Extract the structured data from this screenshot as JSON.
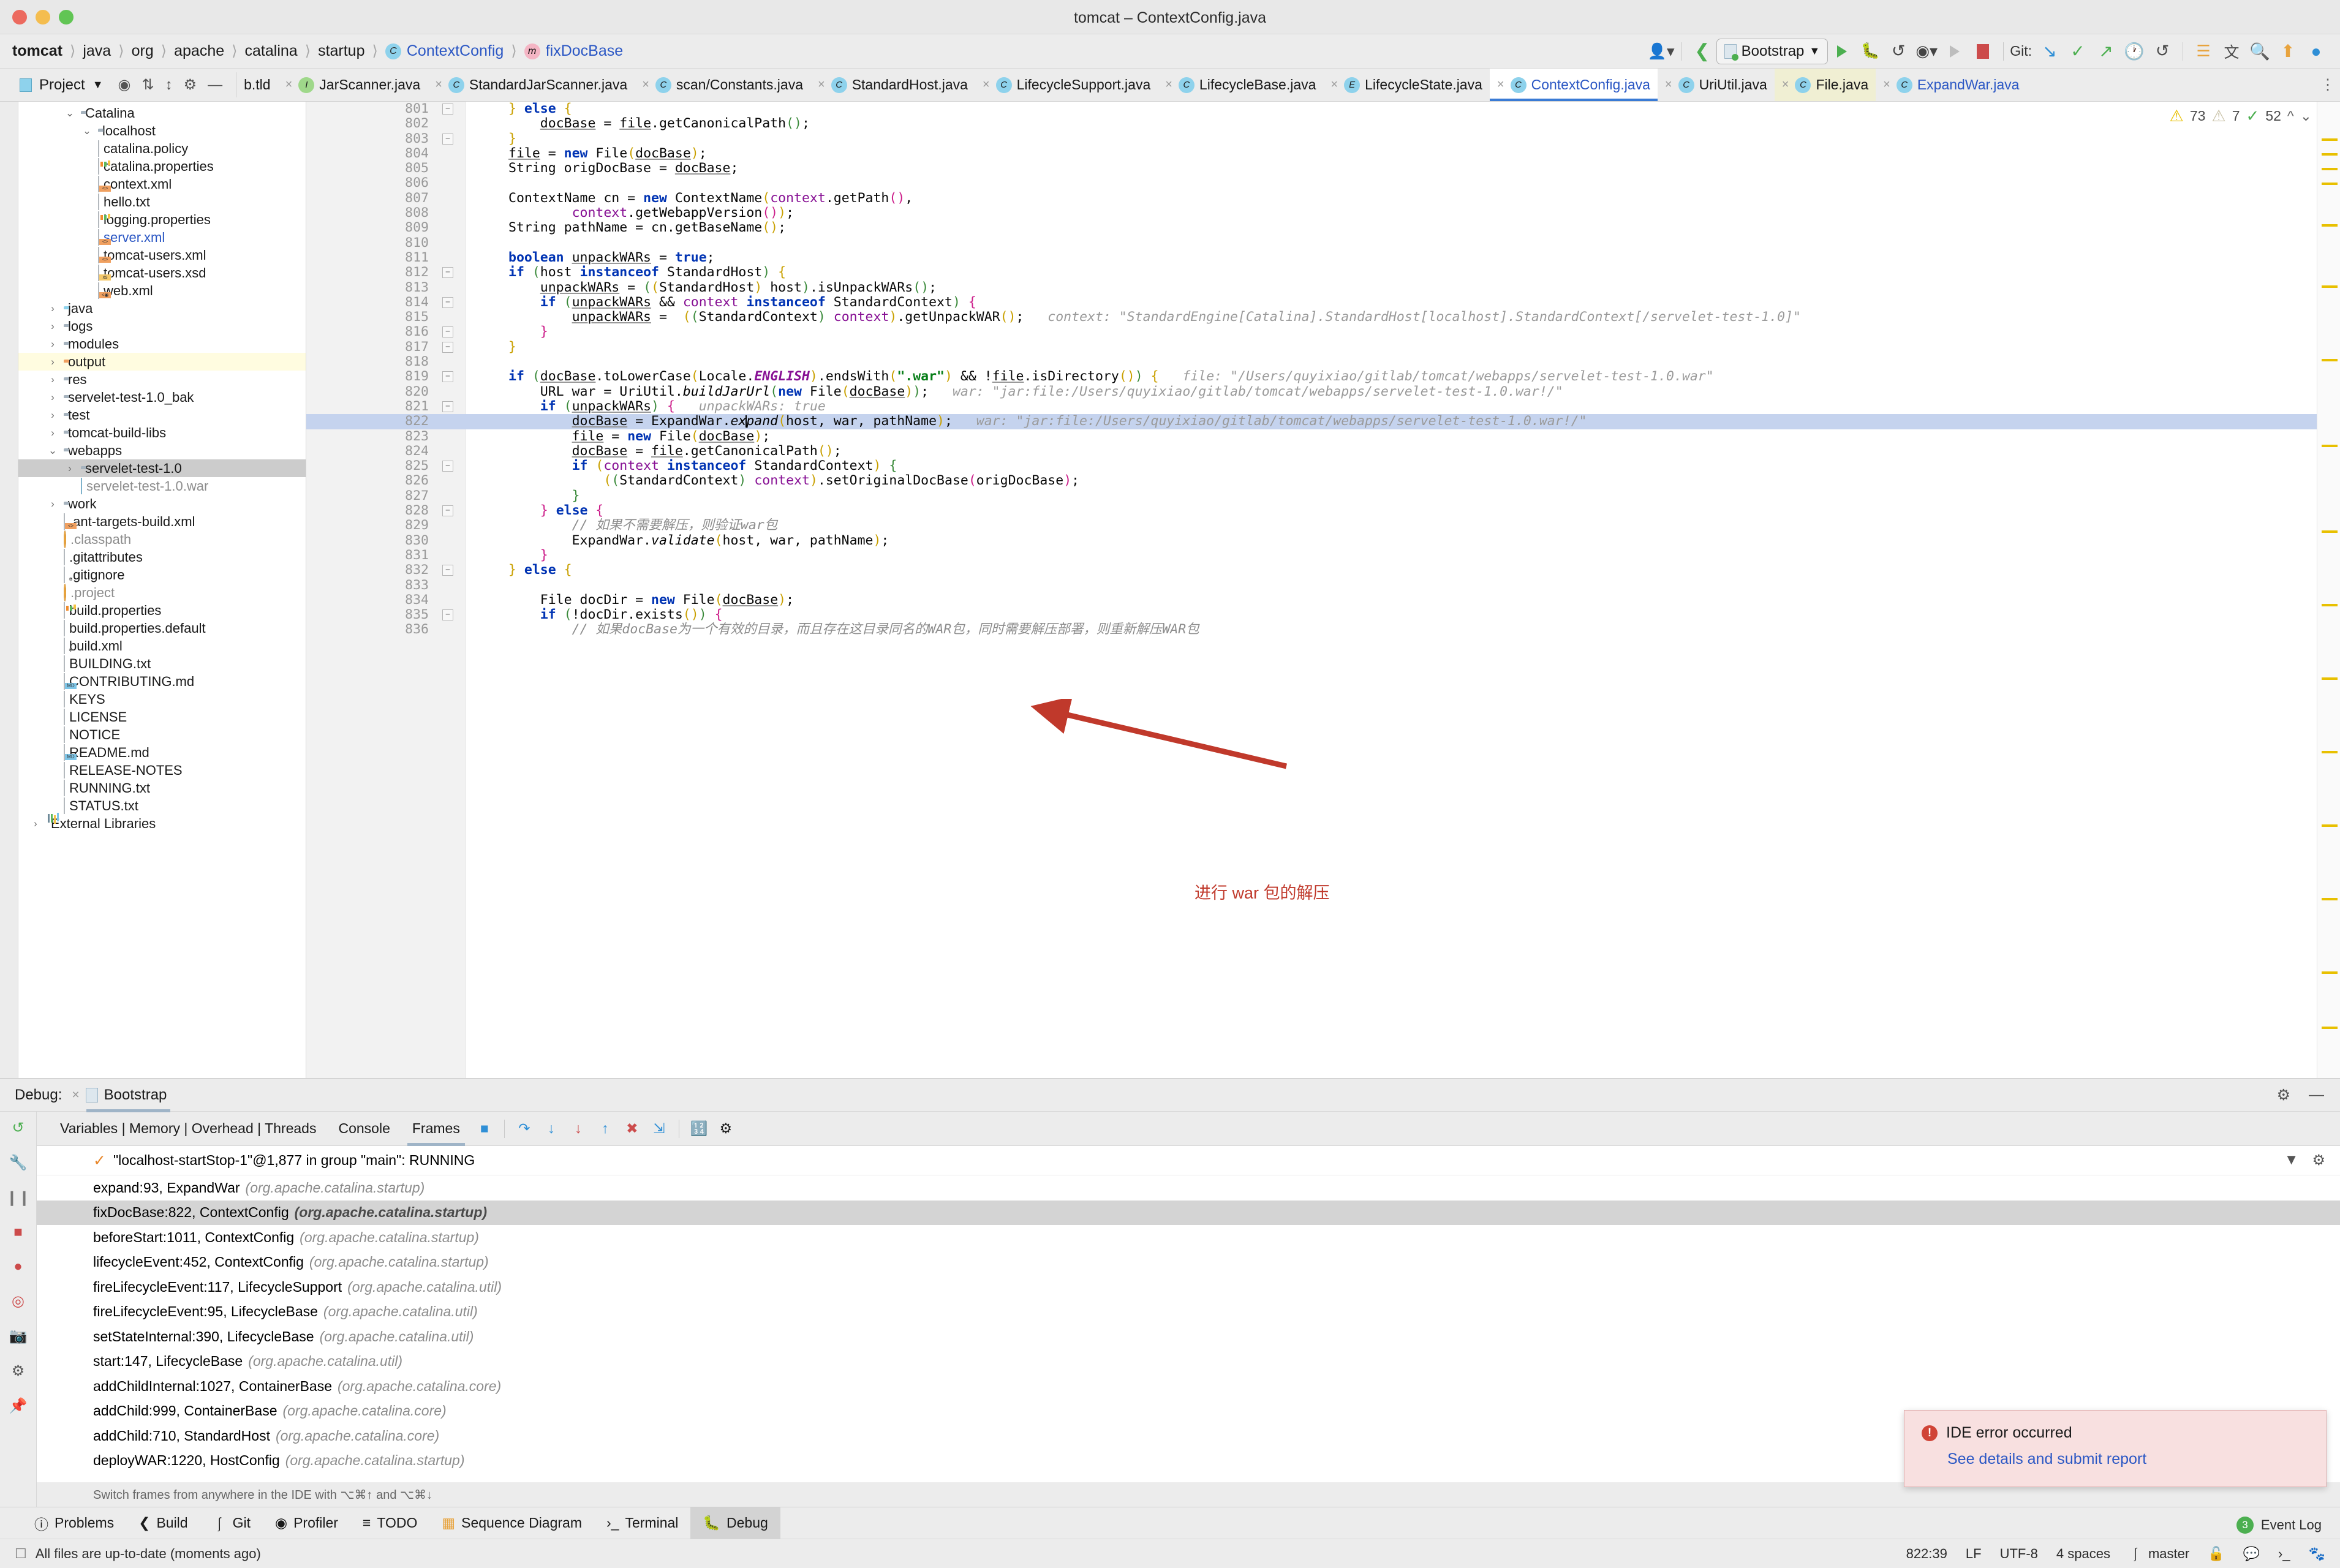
{
  "window": {
    "title": "tomcat – ContextConfig.java"
  },
  "breadcrumb": {
    "items": [
      {
        "label": "tomcat",
        "style": "bold"
      },
      {
        "label": "java",
        "style": "plain"
      },
      {
        "label": "org",
        "style": "plain"
      },
      {
        "label": "apache",
        "style": "plain"
      },
      {
        "label": "catalina",
        "style": "plain"
      },
      {
        "label": "startup",
        "style": "plain"
      },
      {
        "label": "ContextConfig",
        "style": "link",
        "badge": "C"
      },
      {
        "label": "fixDocBase",
        "style": "link",
        "badge": "m"
      }
    ]
  },
  "toolbar": {
    "run_config": "Bootstrap",
    "git_label": "Git:",
    "icons": [
      "user-avatar-icon",
      "back-arrow-icon",
      "run-icon",
      "debug-icon",
      "rerun-icon",
      "coverage-icon",
      "profile-icon",
      "stop-icon",
      "git-update-icon",
      "git-commit-icon",
      "git-push-icon",
      "git-history-icon",
      "git-rollback-icon",
      "diff-icon",
      "translate-icon",
      "search-icon",
      "update-icon",
      "colorpicker-icon"
    ]
  },
  "project_panel": {
    "title": "Project",
    "buttons": [
      "locate-icon",
      "collapse-icon",
      "expand-icon",
      "settings-icon",
      "hide-icon"
    ],
    "tree": [
      {
        "label": "Catalina",
        "indent": 2,
        "arrow": "down",
        "icon": "folder"
      },
      {
        "label": "localhost",
        "indent": 3,
        "arrow": "down",
        "icon": "folder"
      },
      {
        "label": "catalina.policy",
        "indent": 3,
        "arrow": "none",
        "icon": "text-file"
      },
      {
        "label": "catalina.properties",
        "indent": 3,
        "arrow": "none",
        "icon": "properties-file"
      },
      {
        "label": "context.xml",
        "indent": 3,
        "arrow": "none",
        "icon": "xml-file"
      },
      {
        "label": "hello.txt",
        "indent": 3,
        "arrow": "none",
        "icon": "text-file"
      },
      {
        "label": "logging.properties",
        "indent": 3,
        "arrow": "none",
        "icon": "properties-file"
      },
      {
        "label": "server.xml",
        "indent": 3,
        "arrow": "none",
        "icon": "xml-file",
        "color": "blue"
      },
      {
        "label": "tomcat-users.xml",
        "indent": 3,
        "arrow": "none",
        "icon": "xml-file"
      },
      {
        "label": "tomcat-users.xsd",
        "indent": 3,
        "arrow": "none",
        "icon": "xsd-file"
      },
      {
        "label": "web.xml",
        "indent": 3,
        "arrow": "none",
        "icon": "webxml-file"
      },
      {
        "label": "java",
        "indent": 1,
        "arrow": "right",
        "icon": "folder-blue"
      },
      {
        "label": "logs",
        "indent": 1,
        "arrow": "right",
        "icon": "folder"
      },
      {
        "label": "modules",
        "indent": 1,
        "arrow": "right",
        "icon": "folder"
      },
      {
        "label": "output",
        "indent": 1,
        "arrow": "right",
        "icon": "folder-orange",
        "row": "highlight"
      },
      {
        "label": "res",
        "indent": 1,
        "arrow": "right",
        "icon": "folder"
      },
      {
        "label": "servelet-test-1.0_bak",
        "indent": 1,
        "arrow": "right",
        "icon": "folder"
      },
      {
        "label": "test",
        "indent": 1,
        "arrow": "right",
        "icon": "folder"
      },
      {
        "label": "tomcat-build-libs",
        "indent": 1,
        "arrow": "right",
        "icon": "folder"
      },
      {
        "label": "webapps",
        "indent": 1,
        "arrow": "down",
        "icon": "folder"
      },
      {
        "label": "servelet-test-1.0",
        "indent": 2,
        "arrow": "right",
        "icon": "folder",
        "row": "selected"
      },
      {
        "label": "servelet-test-1.0.war",
        "indent": 2,
        "arrow": "none",
        "icon": "archive-file",
        "color": "grey"
      },
      {
        "label": "work",
        "indent": 1,
        "arrow": "right",
        "icon": "folder"
      },
      {
        "label": ".ant-targets-build.xml",
        "indent": 1,
        "arrow": "none",
        "icon": "xml-file"
      },
      {
        "label": ".classpath",
        "indent": 1,
        "arrow": "none",
        "icon": "eclipse-file",
        "color": "grey"
      },
      {
        "label": ".gitattributes",
        "indent": 1,
        "arrow": "none",
        "icon": "text-file"
      },
      {
        "label": ".gitignore",
        "indent": 1,
        "arrow": "none",
        "icon": "ignore-file"
      },
      {
        "label": ".project",
        "indent": 1,
        "arrow": "none",
        "icon": "eclipse-file",
        "color": "grey"
      },
      {
        "label": "build.properties",
        "indent": 1,
        "arrow": "none",
        "icon": "properties-file"
      },
      {
        "label": "build.properties.default",
        "indent": 1,
        "arrow": "none",
        "icon": "text-file"
      },
      {
        "label": "build.xml",
        "indent": 1,
        "arrow": "none",
        "icon": "ant-file"
      },
      {
        "label": "BUILDING.txt",
        "indent": 1,
        "arrow": "none",
        "icon": "text-file"
      },
      {
        "label": "CONTRIBUTING.md",
        "indent": 1,
        "arrow": "none",
        "icon": "markdown-file"
      },
      {
        "label": "KEYS",
        "indent": 1,
        "arrow": "none",
        "icon": "text-file"
      },
      {
        "label": "LICENSE",
        "indent": 1,
        "arrow": "none",
        "icon": "text-file"
      },
      {
        "label": "NOTICE",
        "indent": 1,
        "arrow": "none",
        "icon": "text-file"
      },
      {
        "label": "README.md",
        "indent": 1,
        "arrow": "none",
        "icon": "markdown-file"
      },
      {
        "label": "RELEASE-NOTES",
        "indent": 1,
        "arrow": "none",
        "icon": "text-file"
      },
      {
        "label": "RUNNING.txt",
        "indent": 1,
        "arrow": "none",
        "icon": "text-file"
      },
      {
        "label": "STATUS.txt",
        "indent": 1,
        "arrow": "none",
        "icon": "text-file"
      },
      {
        "label": "External Libraries",
        "indent": 0,
        "arrow": "right",
        "icon": "libraries"
      }
    ]
  },
  "editor_tabs": [
    {
      "label": "b.tld",
      "badge": "",
      "state": "clipped"
    },
    {
      "label": "JarScanner.java",
      "badge": "I",
      "state": "normal"
    },
    {
      "label": "StandardJarScanner.java",
      "badge": "C",
      "state": "normal"
    },
    {
      "label": "scan/Constants.java",
      "badge": "C",
      "state": "normal"
    },
    {
      "label": "StandardHost.java",
      "badge": "C",
      "state": "normal"
    },
    {
      "label": "LifecycleSupport.java",
      "badge": "C",
      "state": "normal"
    },
    {
      "label": "LifecycleBase.java",
      "badge": "C",
      "state": "normal"
    },
    {
      "label": "LifecycleState.java",
      "badge": "E",
      "state": "normal"
    },
    {
      "label": "ContextConfig.java",
      "badge": "C",
      "state": "active"
    },
    {
      "label": "UriUtil.java",
      "badge": "C",
      "state": "normal"
    },
    {
      "label": "File.java",
      "badge": "C",
      "state": "readonly"
    },
    {
      "label": "ExpandWar.java",
      "badge": "C",
      "state": "modified"
    }
  ],
  "inspector": {
    "warnings": "73",
    "weak_warnings": "7",
    "ok": "52"
  },
  "code": {
    "annotation": "进行 war 包的解压",
    "lines": [
      {
        "n": "801",
        "fold": "minus"
      },
      {
        "n": "802"
      },
      {
        "n": "803",
        "fold": "minus"
      },
      {
        "n": "804"
      },
      {
        "n": "805"
      },
      {
        "n": "806"
      },
      {
        "n": "807"
      },
      {
        "n": "808"
      },
      {
        "n": "809"
      },
      {
        "n": "810"
      },
      {
        "n": "811"
      },
      {
        "n": "812",
        "fold": "minus"
      },
      {
        "n": "813"
      },
      {
        "n": "814",
        "fold": "minus"
      },
      {
        "n": "815"
      },
      {
        "n": "816",
        "fold": "minus"
      },
      {
        "n": "817",
        "fold": "minus"
      },
      {
        "n": "818"
      },
      {
        "n": "819",
        "fold": "minus"
      },
      {
        "n": "820"
      },
      {
        "n": "821",
        "fold": "minus"
      },
      {
        "n": "822",
        "current": true
      },
      {
        "n": "823"
      },
      {
        "n": "824"
      },
      {
        "n": "825",
        "fold": "minus"
      },
      {
        "n": "826"
      },
      {
        "n": "827"
      },
      {
        "n": "828",
        "fold": "minus"
      },
      {
        "n": "829"
      },
      {
        "n": "830"
      },
      {
        "n": "831"
      },
      {
        "n": "832",
        "fold": "minus"
      },
      {
        "n": "833"
      },
      {
        "n": "834"
      },
      {
        "n": "835",
        "fold": "minus"
      },
      {
        "n": "836"
      }
    ],
    "inlay_hints": {
      "line_815": "context: \"StandardEngine[Catalina].StandardHost[localhost].StandardContext[/servelet-test-1.0]\"",
      "line_819": "file: \"/Users/quyixiao/gitlab/tomcat/webapps/servelet-test-1.0.war\"",
      "line_820": "war: \"jar:file:/Users/quyixiao/gitlab/tomcat/webapps/servelet-test-1.0.war!/\"",
      "line_821": "unpackWARs: true",
      "line_822": "war: \"jar:file:/Users/quyixiao/gitlab/tomcat/webapps/servelet-test-1.0.war!/\""
    },
    "comments": {
      "line_829": "// 如果不需要解压，则验证war包",
      "line_836": "// 如果docBase为一个有效的目录，而且存在这目录同名的WAR包，同时需要解压部署，则重新解压WAR包"
    }
  },
  "debug": {
    "label": "Debug:",
    "session": "Bootstrap",
    "tabs": [
      "Variables | Memory | Overhead | Threads",
      "Console",
      "Frames"
    ],
    "active_tab": "Frames",
    "thread": "\"localhost-startStop-1\"@1,877 in group \"main\": RUNNING",
    "frames": [
      {
        "method": "expand:93, ExpandWar",
        "pkg": "(org.apache.catalina.startup)"
      },
      {
        "method": "fixDocBase:822, ContextConfig",
        "pkg": "(org.apache.catalina.startup)",
        "selected": true
      },
      {
        "method": "beforeStart:1011, ContextConfig",
        "pkg": "(org.apache.catalina.startup)"
      },
      {
        "method": "lifecycleEvent:452, ContextConfig",
        "pkg": "(org.apache.catalina.startup)"
      },
      {
        "method": "fireLifecycleEvent:117, LifecycleSupport",
        "pkg": "(org.apache.catalina.util)"
      },
      {
        "method": "fireLifecycleEvent:95, LifecycleBase",
        "pkg": "(org.apache.catalina.util)"
      },
      {
        "method": "setStateInternal:390, LifecycleBase",
        "pkg": "(org.apache.catalina.util)"
      },
      {
        "method": "start:147, LifecycleBase",
        "pkg": "(org.apache.catalina.util)"
      },
      {
        "method": "addChildInternal:1027, ContainerBase",
        "pkg": "(org.apache.catalina.core)"
      },
      {
        "method": "addChild:999, ContainerBase",
        "pkg": "(org.apache.catalina.core)"
      },
      {
        "method": "addChild:710, StandardHost",
        "pkg": "(org.apache.catalina.core)"
      },
      {
        "method": "deployWAR:1220, HostConfig",
        "pkg": "(org.apache.catalina.startup)"
      }
    ],
    "hint": "Switch frames from anywhere in the IDE with ⌥⌘↑ and ⌥⌘↓"
  },
  "tool_windows": [
    {
      "label": "Problems",
      "icon": "problems-icon"
    },
    {
      "label": "Build",
      "icon": "build-icon"
    },
    {
      "label": "Git",
      "icon": "git-icon"
    },
    {
      "label": "Profiler",
      "icon": "profiler-icon"
    },
    {
      "label": "TODO",
      "icon": "todo-icon"
    },
    {
      "label": "Sequence Diagram",
      "icon": "sequence-diagram-icon"
    },
    {
      "label": "Terminal",
      "icon": "terminal-icon"
    },
    {
      "label": "Debug",
      "icon": "debug-icon",
      "active": true
    }
  ],
  "notification": {
    "title": "IDE error occurred",
    "link": "See details and submit report"
  },
  "event_log": {
    "count": "3",
    "label": "Event Log"
  },
  "status_bar": {
    "message": "All files are up-to-date (moments ago)",
    "caret": "822:39",
    "line_sep": "LF",
    "encoding": "UTF-8",
    "indent": "4 spaces",
    "branch": "master"
  }
}
